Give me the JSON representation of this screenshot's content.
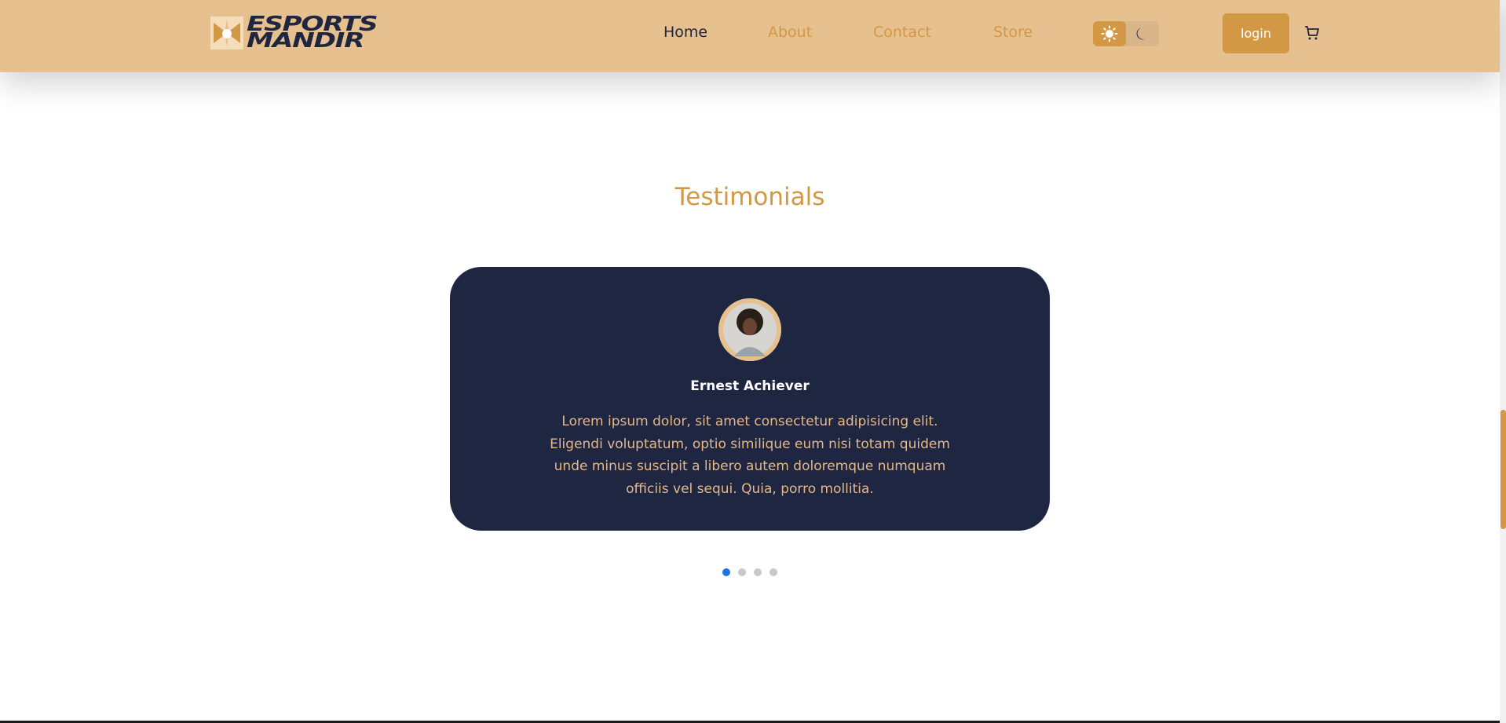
{
  "navbar": {
    "logo": {
      "line1": "ESPORTS",
      "line2": "MANDIR"
    },
    "links": {
      "home": "Home",
      "about": "About",
      "contact": "Contact",
      "store": "Store"
    },
    "login_label": "login",
    "theme": {
      "active": "light"
    }
  },
  "testimonials": {
    "title": "Testimonials",
    "name": "Ernest Achiever",
    "text": "Lorem ipsum dolor, sit amet consectetur adipisicing elit. Eligendi voluptatum, optio similique eum nisi totam quidem unde minus suscipit a libero autem doloremque numquam officiis vel sequi. Quia, porro mollitia.",
    "slides": 4,
    "active_slide": 1
  },
  "colors": {
    "nav_bg": "#e6c08f",
    "accent": "#d39843",
    "card_bg": "#1f2642",
    "dot_active": "#1a73e8",
    "dot_inactive": "#c8c8c8"
  }
}
